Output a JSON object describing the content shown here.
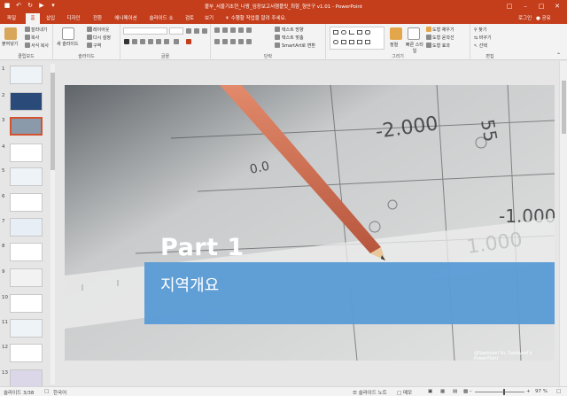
{
  "window": {
    "title": "볼부_서울기초현_나왕_임장보고서행플릿_최항_형안구 v1.01 - PowerPoint",
    "qat": [
      "save-icon",
      "undo-icon",
      "redo-icon",
      "start-icon",
      "customize-icon"
    ],
    "controls": [
      "minimize-icon",
      "restore-icon",
      "maximize-icon",
      "close-icon"
    ]
  },
  "tabs": {
    "items": [
      "파일",
      "홈",
      "삽입",
      "디자인",
      "전환",
      "애니메이션",
      "슬라이드 쇼",
      "검토",
      "보기"
    ],
    "active": "홈",
    "tell_me": "수행할 작업을 알려 주세요.",
    "login": "로그인",
    "share": "공유"
  },
  "ribbon": {
    "clipboard": {
      "name": "클립보드",
      "paste": "붙여넣기",
      "cut": "잘라내기",
      "copy": "복사",
      "format": "서식 복사"
    },
    "slides": {
      "name": "슬라이드",
      "new_slide": "새 슬라이드",
      "layout": "레이아웃",
      "reset": "다시 설정",
      "section": "구역"
    },
    "font": {
      "name": "글꼴"
    },
    "paragraph": {
      "name": "단락",
      "text_dir": "텍스트 방향",
      "align_text": "텍스트 맞춤",
      "smartart": "SmartArt로 변환"
    },
    "drawing": {
      "name": "그리기",
      "arrange": "정렬",
      "quick_styles": "빠른 스타일",
      "fill": "도형 채우기",
      "outline": "도형 윤곽선",
      "effects": "도형 효과"
    },
    "editing": {
      "name": "편집",
      "find": "찾기",
      "replace": "바꾸기",
      "select": "선택"
    }
  },
  "thumbnails": [
    "1",
    "2",
    "3",
    "4",
    "5",
    "6",
    "7",
    "8",
    "9",
    "10",
    "11",
    "12",
    "13"
  ],
  "slide": {
    "title": "Part 1",
    "subtitle": "지역개요",
    "credit": "@Saebyeol Yu, Saebyeol's PowerPoint"
  },
  "status": {
    "slide_counter": "슬라이드 3/38",
    "language": "한국어",
    "notes": "슬라이드 노트",
    "comments": "메모",
    "zoom": "97 %"
  }
}
